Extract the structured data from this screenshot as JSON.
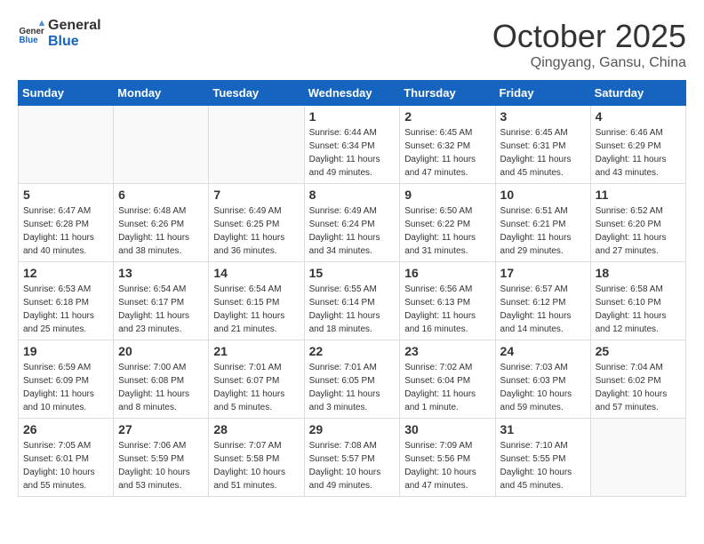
{
  "header": {
    "logo_line1": "General",
    "logo_line2": "Blue",
    "month": "October 2025",
    "location": "Qingyang, Gansu, China"
  },
  "days_of_week": [
    "Sunday",
    "Monday",
    "Tuesday",
    "Wednesday",
    "Thursday",
    "Friday",
    "Saturday"
  ],
  "weeks": [
    [
      {
        "day": "",
        "info": ""
      },
      {
        "day": "",
        "info": ""
      },
      {
        "day": "",
        "info": ""
      },
      {
        "day": "1",
        "info": "Sunrise: 6:44 AM\nSunset: 6:34 PM\nDaylight: 11 hours\nand 49 minutes."
      },
      {
        "day": "2",
        "info": "Sunrise: 6:45 AM\nSunset: 6:32 PM\nDaylight: 11 hours\nand 47 minutes."
      },
      {
        "day": "3",
        "info": "Sunrise: 6:45 AM\nSunset: 6:31 PM\nDaylight: 11 hours\nand 45 minutes."
      },
      {
        "day": "4",
        "info": "Sunrise: 6:46 AM\nSunset: 6:29 PM\nDaylight: 11 hours\nand 43 minutes."
      }
    ],
    [
      {
        "day": "5",
        "info": "Sunrise: 6:47 AM\nSunset: 6:28 PM\nDaylight: 11 hours\nand 40 minutes."
      },
      {
        "day": "6",
        "info": "Sunrise: 6:48 AM\nSunset: 6:26 PM\nDaylight: 11 hours\nand 38 minutes."
      },
      {
        "day": "7",
        "info": "Sunrise: 6:49 AM\nSunset: 6:25 PM\nDaylight: 11 hours\nand 36 minutes."
      },
      {
        "day": "8",
        "info": "Sunrise: 6:49 AM\nSunset: 6:24 PM\nDaylight: 11 hours\nand 34 minutes."
      },
      {
        "day": "9",
        "info": "Sunrise: 6:50 AM\nSunset: 6:22 PM\nDaylight: 11 hours\nand 31 minutes."
      },
      {
        "day": "10",
        "info": "Sunrise: 6:51 AM\nSunset: 6:21 PM\nDaylight: 11 hours\nand 29 minutes."
      },
      {
        "day": "11",
        "info": "Sunrise: 6:52 AM\nSunset: 6:20 PM\nDaylight: 11 hours\nand 27 minutes."
      }
    ],
    [
      {
        "day": "12",
        "info": "Sunrise: 6:53 AM\nSunset: 6:18 PM\nDaylight: 11 hours\nand 25 minutes."
      },
      {
        "day": "13",
        "info": "Sunrise: 6:54 AM\nSunset: 6:17 PM\nDaylight: 11 hours\nand 23 minutes."
      },
      {
        "day": "14",
        "info": "Sunrise: 6:54 AM\nSunset: 6:15 PM\nDaylight: 11 hours\nand 21 minutes."
      },
      {
        "day": "15",
        "info": "Sunrise: 6:55 AM\nSunset: 6:14 PM\nDaylight: 11 hours\nand 18 minutes."
      },
      {
        "day": "16",
        "info": "Sunrise: 6:56 AM\nSunset: 6:13 PM\nDaylight: 11 hours\nand 16 minutes."
      },
      {
        "day": "17",
        "info": "Sunrise: 6:57 AM\nSunset: 6:12 PM\nDaylight: 11 hours\nand 14 minutes."
      },
      {
        "day": "18",
        "info": "Sunrise: 6:58 AM\nSunset: 6:10 PM\nDaylight: 11 hours\nand 12 minutes."
      }
    ],
    [
      {
        "day": "19",
        "info": "Sunrise: 6:59 AM\nSunset: 6:09 PM\nDaylight: 11 hours\nand 10 minutes."
      },
      {
        "day": "20",
        "info": "Sunrise: 7:00 AM\nSunset: 6:08 PM\nDaylight: 11 hours\nand 8 minutes."
      },
      {
        "day": "21",
        "info": "Sunrise: 7:01 AM\nSunset: 6:07 PM\nDaylight: 11 hours\nand 5 minutes."
      },
      {
        "day": "22",
        "info": "Sunrise: 7:01 AM\nSunset: 6:05 PM\nDaylight: 11 hours\nand 3 minutes."
      },
      {
        "day": "23",
        "info": "Sunrise: 7:02 AM\nSunset: 6:04 PM\nDaylight: 11 hours\nand 1 minute."
      },
      {
        "day": "24",
        "info": "Sunrise: 7:03 AM\nSunset: 6:03 PM\nDaylight: 10 hours\nand 59 minutes."
      },
      {
        "day": "25",
        "info": "Sunrise: 7:04 AM\nSunset: 6:02 PM\nDaylight: 10 hours\nand 57 minutes."
      }
    ],
    [
      {
        "day": "26",
        "info": "Sunrise: 7:05 AM\nSunset: 6:01 PM\nDaylight: 10 hours\nand 55 minutes."
      },
      {
        "day": "27",
        "info": "Sunrise: 7:06 AM\nSunset: 5:59 PM\nDaylight: 10 hours\nand 53 minutes."
      },
      {
        "day": "28",
        "info": "Sunrise: 7:07 AM\nSunset: 5:58 PM\nDaylight: 10 hours\nand 51 minutes."
      },
      {
        "day": "29",
        "info": "Sunrise: 7:08 AM\nSunset: 5:57 PM\nDaylight: 10 hours\nand 49 minutes."
      },
      {
        "day": "30",
        "info": "Sunrise: 7:09 AM\nSunset: 5:56 PM\nDaylight: 10 hours\nand 47 minutes."
      },
      {
        "day": "31",
        "info": "Sunrise: 7:10 AM\nSunset: 5:55 PM\nDaylight: 10 hours\nand 45 minutes."
      },
      {
        "day": "",
        "info": ""
      }
    ]
  ]
}
